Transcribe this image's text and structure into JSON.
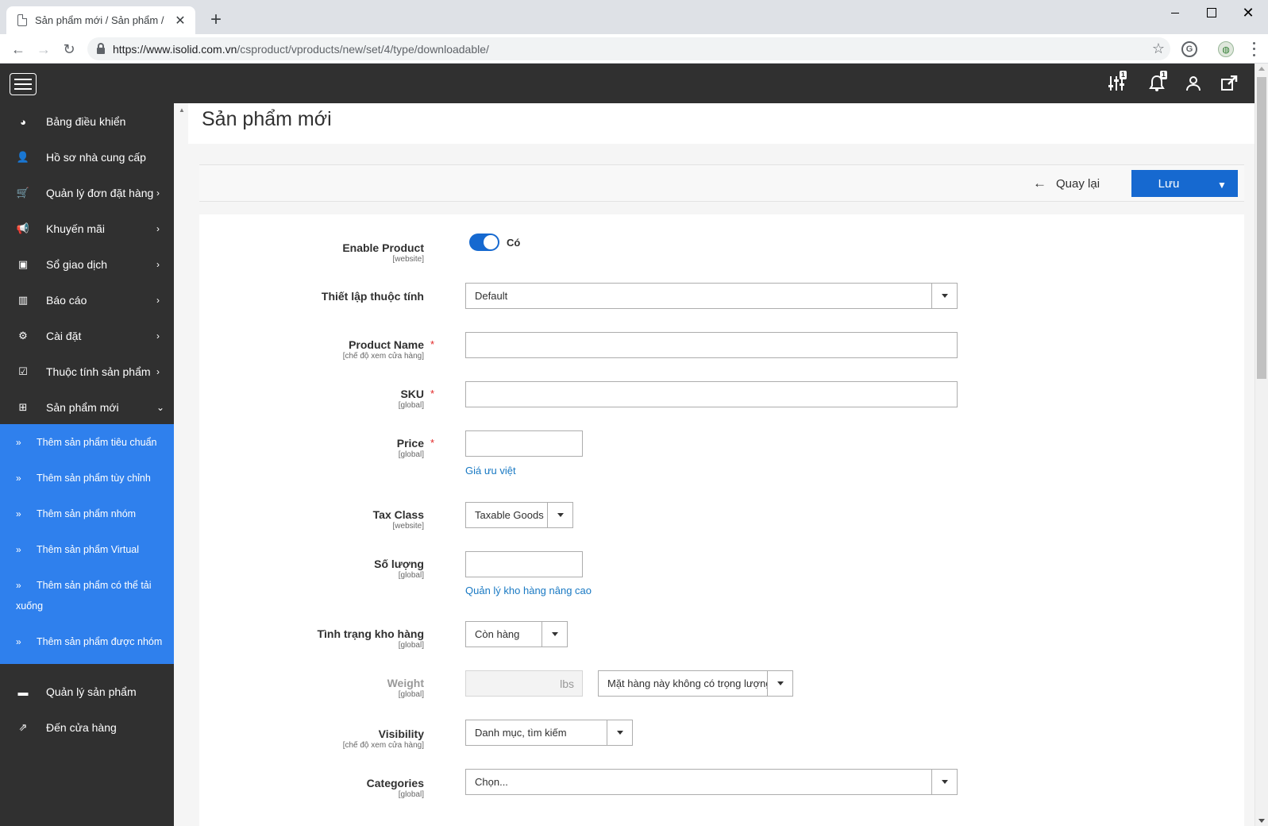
{
  "browser": {
    "tab_title": "Sản phẩm mới / Sản phẩm /",
    "tab_close": "✕",
    "new_tab": "+",
    "url_host": "https://www.isolid.com.vn",
    "url_path": "/csproduct/vproducts/new/set/4/type/downloadable/"
  },
  "header": {
    "badge_settings": "1",
    "badge_bell": "1"
  },
  "sidebar": {
    "items": [
      {
        "label": "Bảng điều khiển",
        "icon": "dashboard-icon",
        "glyph": "◕",
        "chevron": ""
      },
      {
        "label": "Hồ sơ nhà cung cấp",
        "icon": "user-icon",
        "glyph": "👤",
        "chevron": ""
      },
      {
        "label": "Quản lý đơn đặt hàng",
        "icon": "cart-icon",
        "glyph": "🛒",
        "chevron": "›"
      },
      {
        "label": "Khuyến mãi",
        "icon": "bullhorn-icon",
        "glyph": "📢",
        "chevron": "›"
      },
      {
        "label": "Sổ giao dịch",
        "icon": "money-icon",
        "glyph": "▣",
        "chevron": "›"
      },
      {
        "label": "Báo cáo",
        "icon": "bar-chart-icon",
        "glyph": "▥",
        "chevron": "›"
      },
      {
        "label": "Cài đặt",
        "icon": "gear-icon",
        "glyph": "⚙",
        "chevron": "›"
      },
      {
        "label": "Thuộc tính sản phẩm",
        "icon": "checkbox-icon",
        "glyph": "☑",
        "chevron": "›"
      },
      {
        "label": "Sản phẩm mới",
        "icon": "plus-square-icon",
        "glyph": "⊞",
        "chevron": "⌄"
      }
    ],
    "sub_items": [
      "Thêm sản phẩm tiêu chuẩn",
      "Thêm sản phẩm tùy chỉnh",
      "Thêm sản phẩm nhóm",
      "Thêm sản phẩm Virtual",
      "Thêm sản phẩm có thể tải xuống",
      "Thêm sản phẩm được nhóm"
    ],
    "sub_arrow": "»",
    "bottom_items": [
      {
        "label": "Quản lý sản phẩm",
        "icon": "folder-icon",
        "glyph": "▬"
      },
      {
        "label": "Đến cửa hàng",
        "icon": "external-link-icon",
        "glyph": "⇗"
      }
    ]
  },
  "page": {
    "title": "Sản phẩm mới",
    "back_label": "Quay lại",
    "save_label": "Lưu"
  },
  "form": {
    "enable_product": {
      "label": "Enable Product",
      "scope": "[website]",
      "value": "Có"
    },
    "attribute_set": {
      "label": "Thiết lập thuộc tính",
      "value": "Default"
    },
    "product_name": {
      "label": "Product Name",
      "scope": "[chế độ xem cửa hàng]",
      "value": ""
    },
    "sku": {
      "label": "SKU",
      "scope": "[global]",
      "value": ""
    },
    "price": {
      "label": "Price",
      "scope": "[global]",
      "value": "",
      "link": "Giá ưu việt"
    },
    "tax_class": {
      "label": "Tax Class",
      "scope": "[website]",
      "value": "Taxable Goods"
    },
    "quantity": {
      "label": "Số lượng",
      "scope": "[global]",
      "value": "",
      "link": "Quản lý kho hàng nâng cao"
    },
    "stock_status": {
      "label": "Tình trạng kho hàng",
      "scope": "[global]",
      "value": "Còn hàng"
    },
    "weight": {
      "label": "Weight",
      "scope": "[global]",
      "unit": "lbs",
      "select": "Mặt hàng này không có trọng lượng"
    },
    "visibility": {
      "label": "Visibility",
      "scope": "[chế độ xem cửa hàng]",
      "value": "Danh mục, tìm kiếm"
    },
    "categories": {
      "label": "Categories",
      "scope": "[global]",
      "value": "Chọn..."
    },
    "required_mark": "*"
  },
  "colors": {
    "sidebar_bg": "#303030",
    "submenu_bg": "#2f80ed",
    "accent": "#1669d0",
    "link": "#1979c3"
  }
}
